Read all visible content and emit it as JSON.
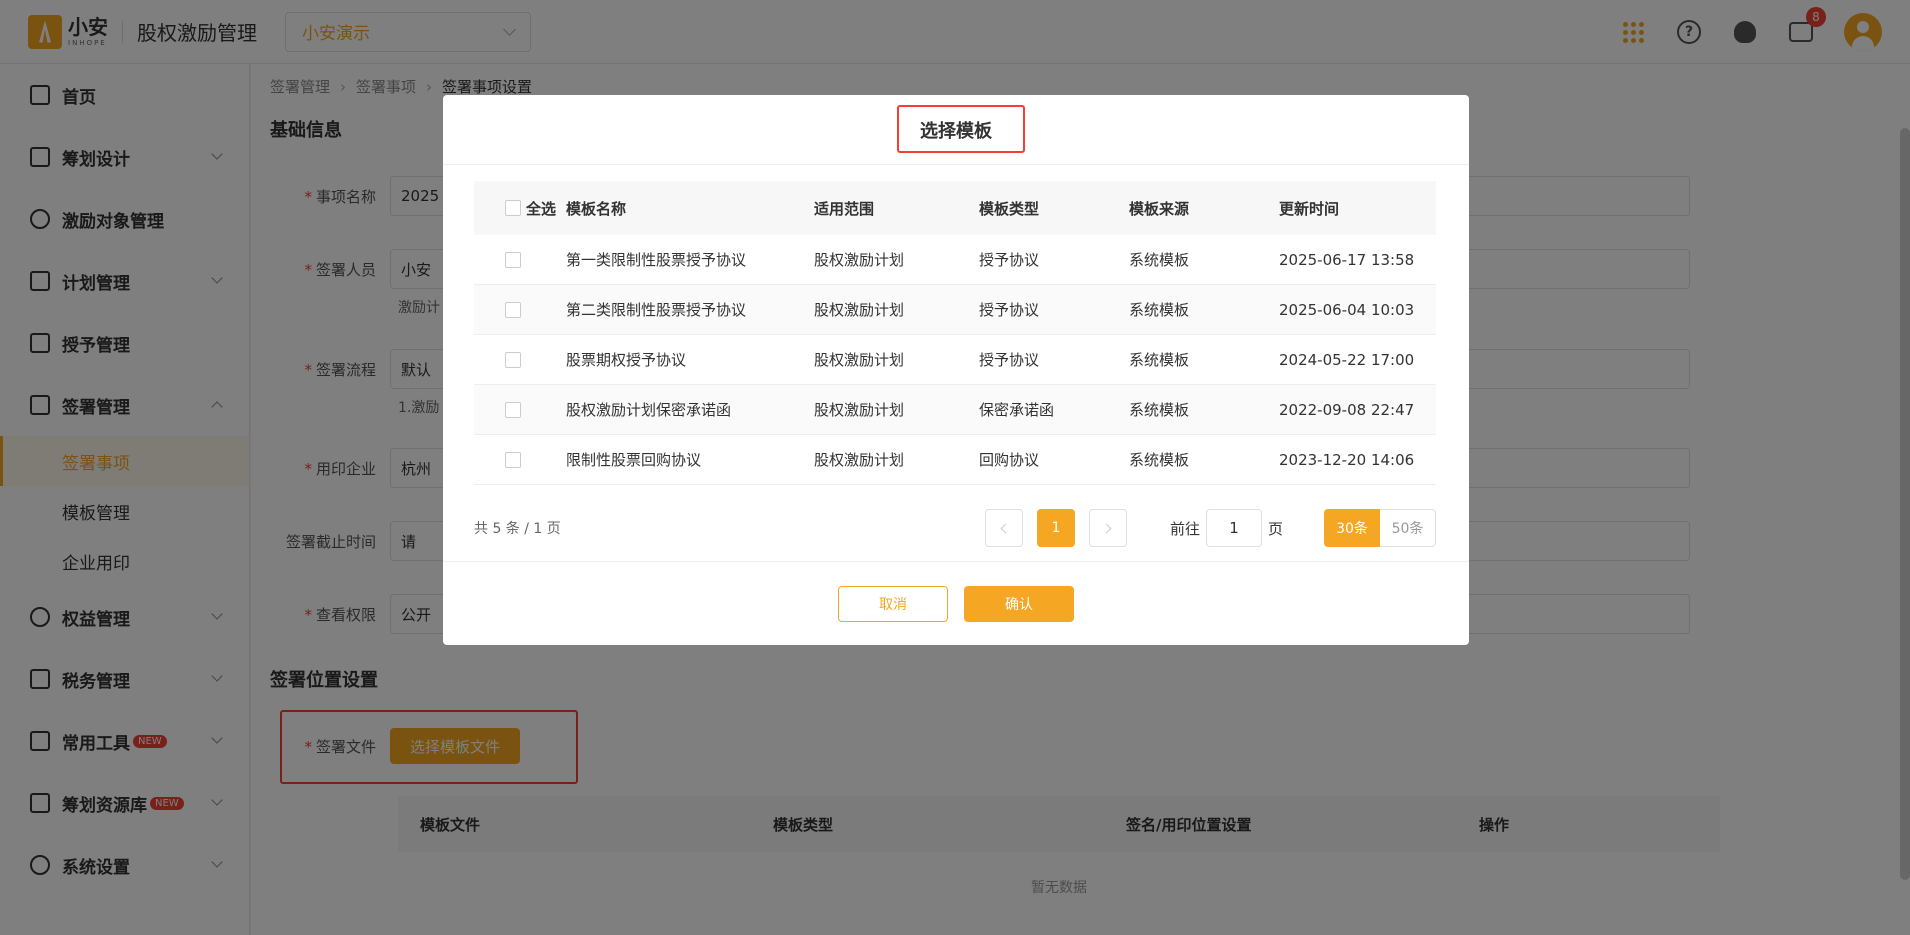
{
  "header": {
    "logo_text": "小安",
    "logo_sub": "INHOPE",
    "app_title": "股权激励管理",
    "company": "小安演示",
    "message_count": "8"
  },
  "sidebar": {
    "items": [
      {
        "label": "首页",
        "icon": "home-icon"
      },
      {
        "label": "筹划设计",
        "icon": "edit-icon"
      },
      {
        "label": "激励对象管理",
        "icon": "users-icon"
      },
      {
        "label": "计划管理",
        "icon": "grid-icon"
      },
      {
        "label": "授予管理",
        "icon": "book-icon"
      },
      {
        "label": "签署管理",
        "icon": "sign-icon"
      },
      {
        "label": "权益管理",
        "icon": "shield-icon"
      },
      {
        "label": "税务管理",
        "icon": "tax-icon"
      },
      {
        "label": "常用工具",
        "icon": "toolbox-icon",
        "tag": "NEW"
      },
      {
        "label": "筹划资源库",
        "icon": "layers-icon",
        "tag": "NEW"
      },
      {
        "label": "系统设置",
        "icon": "settings-icon"
      }
    ],
    "sub_items": [
      "签署事项",
      "模板管理",
      "企业用印"
    ]
  },
  "main": {
    "breadcrumb": [
      "签署管理",
      "签署事项",
      "签署事项设置"
    ],
    "basic_title": "基础信息",
    "fields": {
      "name_label": "事项名称",
      "name_value": "2025",
      "signers_label": "签署人员",
      "signers_value": "小安",
      "signers_hint": "激励计",
      "flow_label": "签署流程",
      "flow_value": "默认",
      "flow_hint": "1.激励",
      "seal_label": "用印企业",
      "seal_value": "杭州",
      "deadline_label": "签署截止时间",
      "deadline_value": "请",
      "permission_label": "查看权限",
      "permission_value": "公开"
    },
    "position_title": "签署位置设置",
    "file_label": "签署文件",
    "select_file_button": "选择模板文件",
    "files_table": {
      "headers": [
        "模板文件",
        "模板类型",
        "签名/用印位置设置",
        "操作"
      ],
      "empty": "暂无数据"
    }
  },
  "modal": {
    "title": "选择模板",
    "select_all": "全选",
    "headers": [
      "模板名称",
      "适用范围",
      "模板类型",
      "模板来源",
      "更新时间"
    ],
    "rows": [
      [
        "第一类限制性股票授予协议",
        "股权激励计划",
        "授予协议",
        "系统模板",
        "2025-06-17 13:58"
      ],
      [
        "第二类限制性股票授予协议",
        "股权激励计划",
        "授予协议",
        "系统模板",
        "2025-06-04 10:03"
      ],
      [
        "股票期权授予协议",
        "股权激励计划",
        "授予协议",
        "系统模板",
        "2024-05-22 17:00"
      ],
      [
        "股权激励计划保密承诺函",
        "股权激励计划",
        "保密承诺函",
        "系统模板",
        "2022-09-08 22:47"
      ],
      [
        "限制性股票回购协议",
        "股权激励计划",
        "回购协议",
        "系统模板",
        "2023-12-20 14:06"
      ]
    ],
    "pager": {
      "total": "共 5 条 / 1 页",
      "current_page": "1",
      "goto_prefix": "前往",
      "goto_value": "1",
      "goto_suffix": "页",
      "size_30": "30条",
      "size_50": "50条"
    },
    "cancel": "取消",
    "confirm": "确认"
  }
}
